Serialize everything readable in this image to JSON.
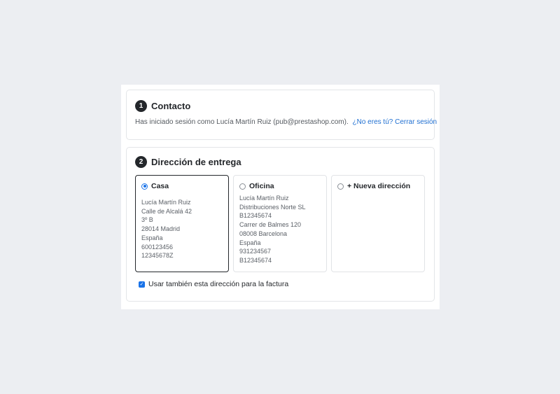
{
  "contact": {
    "step": "1",
    "title": "Contacto",
    "logged_text": "Has iniciado sesión como Lucía Martín Ruiz (pub@prestashop.com).",
    "logout_link": "¿No eres tú? Cerrar sesión"
  },
  "delivery": {
    "step": "2",
    "title": "Dirección de entrega",
    "addresses": [
      {
        "name": "Casa",
        "selected": true,
        "lines": [
          "Lucía Martín Ruiz",
          "Calle de Alcalá 42",
          "3º B",
          "28014 Madrid",
          "España",
          "600123456",
          "12345678Z"
        ]
      },
      {
        "name": "Oficina",
        "selected": false,
        "lines": [
          "Lucía Martín Ruiz",
          "Distribuciones Norte SL",
          "B12345674",
          "Carrer de Balmes 120",
          "08008 Barcelona",
          "España",
          "931234567",
          "B12345674"
        ]
      },
      {
        "name": "+ Nueva dirección",
        "selected": false,
        "lines": []
      }
    ],
    "invoice_checkbox": {
      "label": "Usar también esta dirección para la factura",
      "checked": true
    }
  },
  "colors": {
    "accent": "#1a73e8",
    "link": "#1f6fd1",
    "text": "#24272b",
    "background": "#eceef2"
  }
}
